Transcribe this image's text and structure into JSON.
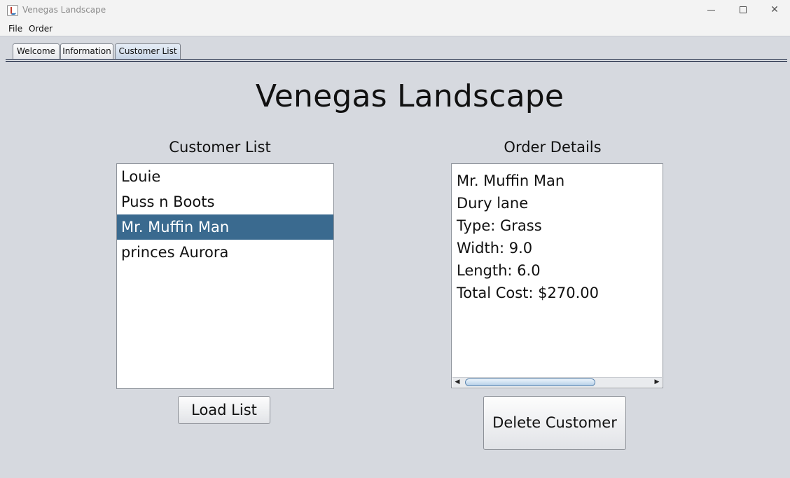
{
  "window": {
    "title": "Venegas Landscape",
    "controls": {
      "minimize": "minimize",
      "maximize": "maximize",
      "close": "✕"
    }
  },
  "menu": {
    "items": [
      "File",
      "Order"
    ]
  },
  "tabs": [
    {
      "label": "Welcome",
      "active": false
    },
    {
      "label": "Information",
      "active": false
    },
    {
      "label": "Customer List",
      "active": true
    }
  ],
  "main": {
    "title": "Venegas Landscape",
    "customer_list": {
      "label": "Customer List",
      "items": [
        "Louie",
        "Puss n Boots",
        "Mr. Muffin Man",
        "princes Aurora"
      ],
      "selected_index": 2
    },
    "order_details": {
      "label": "Order Details",
      "lines": [
        "Mr. Muffin Man",
        "Dury lane",
        "Type: Grass",
        "Width: 9.0",
        "Length: 6.0",
        "Total Cost: $270.00"
      ]
    },
    "load_button": "Load List",
    "delete_button": "Delete Customer"
  },
  "colors": {
    "background": "#d6d9df",
    "selection": "#3a6a8f",
    "tab_active": "#c6d4e6"
  }
}
